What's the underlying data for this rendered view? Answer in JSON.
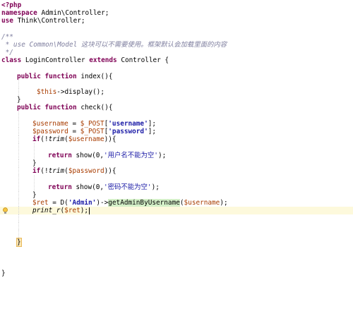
{
  "editor": {
    "lines": {
      "l1": "<?php",
      "l2a": "namespace",
      "l2b": " Admin\\Controller;",
      "l3a": "use",
      "l3b": " Think\\Controller;",
      "l5": "/**",
      "l6": " * use Common\\Model 这块可以不需要使用。框架默认会加载里面的内容",
      "l7": " */",
      "l8a": "class",
      "l8b": " LoginController ",
      "l8c": "extends",
      "l8d": " Controller {",
      "l10a": "public",
      "l10b": "function",
      "l10c": " index(){",
      "l12a": "$this",
      "l12b": "->display();",
      "l13": "}",
      "l14a": "public",
      "l14b": "function",
      "l14c": " check(){",
      "l16a": "$username",
      "l16b": " = ",
      "l16c": "$_POST",
      "l16d": "[",
      "l16e": "'username'",
      "l16f": "];",
      "l17a": "$password",
      "l17b": " = ",
      "l17c": "$_POST",
      "l17d": "[",
      "l17e": "'password'",
      "l17f": "];",
      "l18a": "if",
      "l18b": "(!",
      "l18c": "trim",
      "l18d": "(",
      "l18e": "$username",
      "l18f": ")){",
      "l20a": "return",
      "l20b": " show(0,",
      "l20c": "'用户名不能为空'",
      "l20d": ");",
      "l21": "}",
      "l22a": "if",
      "l22b": "(!",
      "l22c": "trim",
      "l22d": "(",
      "l22e": "$password",
      "l22f": ")){",
      "l24a": "return",
      "l24b": " show(0,",
      "l24c": "'密码不能为空'",
      "l24d": ");",
      "l25": "}",
      "l26a": "$ret",
      "l26b": " = D(",
      "l26c": "'Admin'",
      "l26d": ")->",
      "l26e": "getAdminByUsername",
      "l26f": "(",
      "l26g": "$username",
      "l26h": ");",
      "l27a": "print_r",
      "l27b": "(",
      "l27c": "$ret",
      "l27d": ");",
      "l31": "}",
      "l35": "}"
    }
  },
  "colors": {
    "keyword": "#7f0055",
    "variable": "#a83c00",
    "string": "#1a1aa6",
    "comment": "#7f7f9f",
    "current_line": "#fdf9dc"
  },
  "icons": {
    "gutter": "lightbulb-icon"
  }
}
